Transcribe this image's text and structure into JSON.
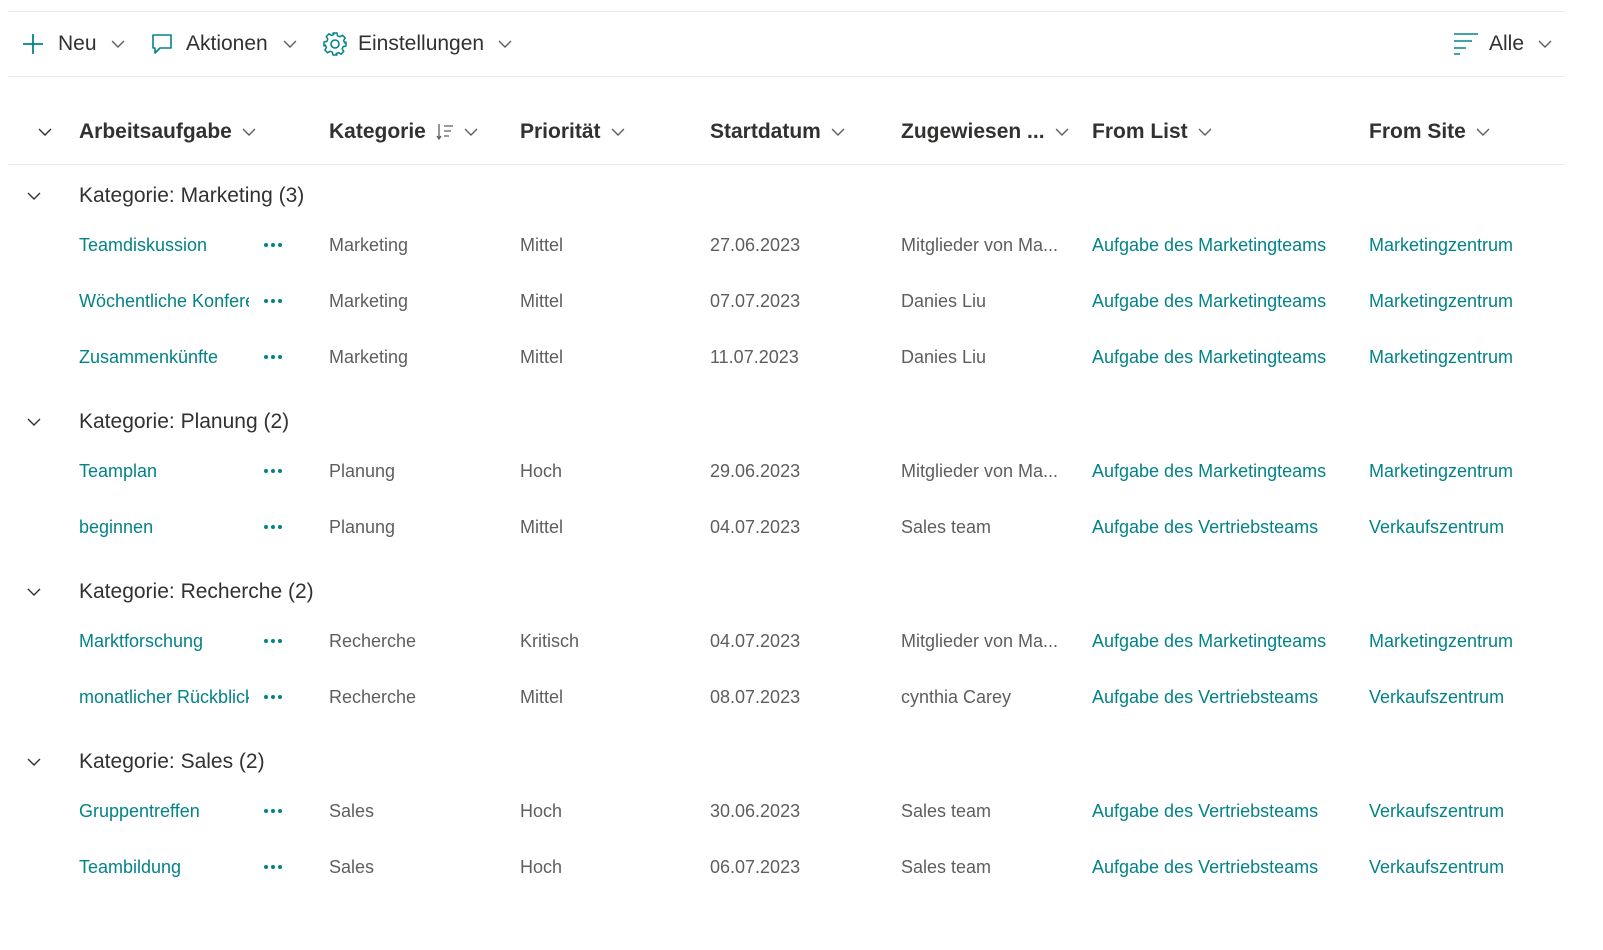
{
  "colors": {
    "accent": "#038387",
    "text": "#323130",
    "secondary_text": "#605e5c",
    "divider": "#edebe9"
  },
  "commandbar": {
    "new_label": "Neu",
    "actions_label": "Aktionen",
    "settings_label": "Einstellungen",
    "view_label": "Alle",
    "icons": [
      "plus-icon",
      "comment-icon",
      "gear-icon",
      "filter-lines-icon",
      "chevron-down-icon"
    ]
  },
  "columns": {
    "title": "Arbeitsaufgabe",
    "category": "Kategorie",
    "priority": "Priorität",
    "start_date": "Startdatum",
    "assigned": "Zugewiesen ...",
    "from_list": "From List",
    "from_site": "From Site"
  },
  "groups": [
    {
      "title": "Kategorie: Marketing (3)",
      "items": [
        {
          "title": "Teamdiskussion",
          "category": "Marketing",
          "priority": "Mittel",
          "start_date": "27.06.2023",
          "assigned": "Mitglieder von Ma...",
          "from_list": "Aufgabe des Marketingteams",
          "from_site": "Marketingzentrum"
        },
        {
          "title": "Wöchentliche Konferenz",
          "category": "Marketing",
          "priority": "Mittel",
          "start_date": "07.07.2023",
          "assigned": "Danies Liu",
          "from_list": "Aufgabe des Marketingteams",
          "from_site": "Marketingzentrum"
        },
        {
          "title": "Zusammenkünfte",
          "category": "Marketing",
          "priority": "Mittel",
          "start_date": "11.07.2023",
          "assigned": "Danies Liu",
          "from_list": "Aufgabe des Marketingteams",
          "from_site": "Marketingzentrum"
        }
      ]
    },
    {
      "title": "Kategorie: Planung (2)",
      "items": [
        {
          "title": "Teamplan",
          "category": "Planung",
          "priority": "Hoch",
          "start_date": "29.06.2023",
          "assigned": "Mitglieder von Ma...",
          "from_list": "Aufgabe des Marketingteams",
          "from_site": "Marketingzentrum"
        },
        {
          "title": "beginnen",
          "category": "Planung",
          "priority": "Mittel",
          "start_date": "04.07.2023",
          "assigned": "Sales team",
          "from_list": "Aufgabe des Vertriebsteams",
          "from_site": "Verkaufszentrum"
        }
      ]
    },
    {
      "title": "Kategorie: Recherche (2)",
      "items": [
        {
          "title": "Marktforschung",
          "category": "Recherche",
          "priority": "Kritisch",
          "start_date": "04.07.2023",
          "assigned": "Mitglieder von Ma...",
          "from_list": "Aufgabe des Marketingteams",
          "from_site": "Marketingzentrum"
        },
        {
          "title": "monatlicher Rückblick",
          "category": "Recherche",
          "priority": "Mittel",
          "start_date": "08.07.2023",
          "assigned": "cynthia Carey",
          "from_list": "Aufgabe des Vertriebsteams",
          "from_site": "Verkaufszentrum"
        }
      ]
    },
    {
      "title": "Kategorie: Sales (2)",
      "items": [
        {
          "title": "Gruppentreffen",
          "category": "Sales",
          "priority": "Hoch",
          "start_date": "30.06.2023",
          "assigned": "Sales team",
          "from_list": "Aufgabe des Vertriebsteams",
          "from_site": "Verkaufszentrum"
        },
        {
          "title": "Teambildung",
          "category": "Sales",
          "priority": "Hoch",
          "start_date": "06.07.2023",
          "assigned": "Sales team",
          "from_list": "Aufgabe des Vertriebsteams",
          "from_site": "Verkaufszentrum"
        }
      ]
    }
  ]
}
